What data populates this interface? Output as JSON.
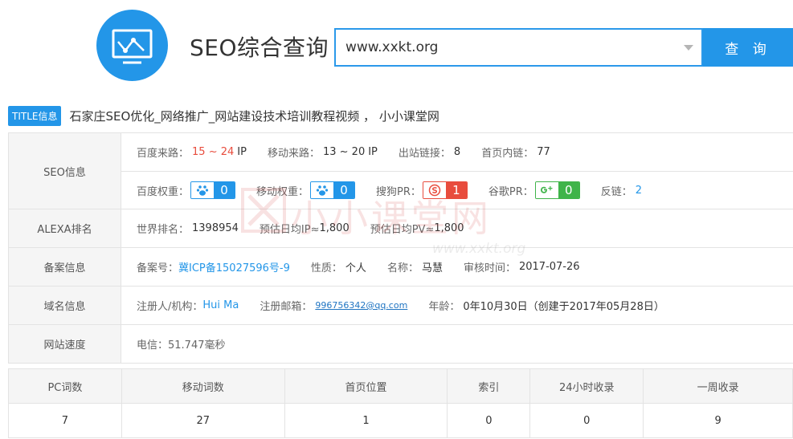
{
  "header": {
    "app_title": "SEO综合查询",
    "search_value": "www.xxkt.org",
    "search_button": "查 询"
  },
  "title_info": {
    "badge": "TITLE信息",
    "text": "石家庄SEO优化_网络推广_网站建设技术培训教程视频 ， 小小课堂网"
  },
  "seo": {
    "label": "SEO信息",
    "baidu_traffic_label": "百度来路：",
    "baidu_traffic_value": "15 ~ 24",
    "baidu_traffic_unit": "IP",
    "mobile_traffic_label": "移动来路：",
    "mobile_traffic_value": "13 ~ 20",
    "mobile_traffic_unit": "IP",
    "outbound_links_label": "出站链接：",
    "outbound_links_value": "8",
    "internal_links_label": "首页内链：",
    "internal_links_value": "77",
    "baidu_weight_label": "百度权重：",
    "baidu_weight_value": "0",
    "mobile_weight_label": "移动权重：",
    "mobile_weight_value": "0",
    "sogou_pr_label": "搜狗PR：",
    "sogou_pr_value": "1",
    "google_pr_label": "谷歌PR：",
    "google_pr_value": "0",
    "backlinks_label": "反链：",
    "backlinks_value": "2"
  },
  "alexa": {
    "label": "ALEXA排名",
    "world_rank_label": "世界排名：",
    "world_rank_value": "1398954",
    "daily_ip_label": "预估日均IP≈",
    "daily_ip_value": "1,800",
    "daily_pv_label": "预估日均PV≈",
    "daily_pv_value": "1,800"
  },
  "icp": {
    "label": "备案信息",
    "number_label": "备案号：",
    "number_value": "冀ICP备15027596号-9",
    "nature_label": "性质：",
    "nature_value": "个人",
    "name_label": "名称：",
    "name_value": "马慧",
    "audit_label": "审核时间：",
    "audit_value": "2017-07-26"
  },
  "domain": {
    "label": "域名信息",
    "registrant_label": "注册人/机构：",
    "registrant_value": "Hui Ma",
    "email_label": "注册邮箱：",
    "email_value": "996756342@qq.com",
    "age_label": "年龄：",
    "age_value": "0年10月30日（创建于2017年05月28日）"
  },
  "speed": {
    "label": "网站速度",
    "telecom": "电信：51.747毫秒"
  },
  "stats": {
    "headers": [
      "PC词数",
      "移动词数",
      "首页位置",
      "索引",
      "24小时收录",
      "一周收录"
    ],
    "values": [
      "7",
      "27",
      "1",
      "0",
      "0",
      "9"
    ]
  },
  "watermark": {
    "text": "小小课堂网",
    "url": "www.xxkt.org"
  },
  "colors": {
    "accent": "#2396e8",
    "red": "#e84c3d",
    "green": "#3fb449"
  }
}
